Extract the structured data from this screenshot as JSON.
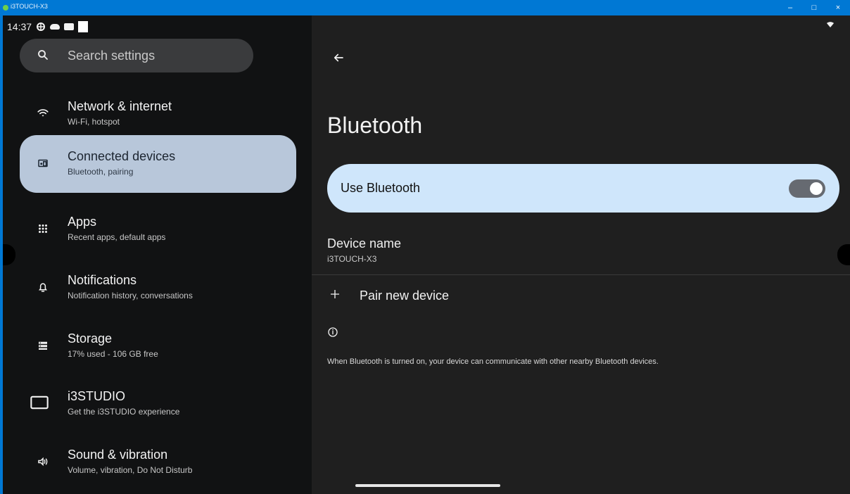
{
  "window": {
    "title": "i3TOUCH-X3",
    "controls": [
      "–",
      "□",
      "×"
    ]
  },
  "status_bar": {
    "time": "14:37",
    "icons": [
      "vpn-icon",
      "cloud-icon",
      "dvr-icon",
      "white-square-icon"
    ],
    "right_icons": [
      "wifi-icon"
    ]
  },
  "search": {
    "placeholder": "Search settings",
    "icon": "search-icon"
  },
  "sidebar": {
    "items": [
      {
        "label": "Network & internet",
        "sublabel": "Wi-Fi, hotspot",
        "icon": "wifi-icon",
        "active": false
      },
      {
        "label": "Connected devices",
        "sublabel": "Bluetooth, pairing",
        "icon": "connected-devices-icon",
        "active": true
      },
      {
        "label": "Apps",
        "sublabel": "Recent apps, default apps",
        "icon": "apps-grid-icon",
        "active": false
      },
      {
        "label": "Notifications",
        "sublabel": "Notification history, conversations",
        "icon": "bell-icon",
        "active": false
      },
      {
        "label": "Storage",
        "sublabel": "17% used - 106 GB free",
        "icon": "storage-icon",
        "active": false
      },
      {
        "label": "i3STUDIO",
        "sublabel": "Get the i3STUDIO experience",
        "icon": "display-icon",
        "active": false
      },
      {
        "label": "Sound & vibration",
        "sublabel": "Volume, vibration, Do Not Disturb",
        "icon": "speaker-icon",
        "active": false
      }
    ]
  },
  "main": {
    "back_icon": "back-arrow-icon",
    "title": "Bluetooth",
    "use_bluetooth": {
      "label": "Use Bluetooth",
      "enabled": true
    },
    "device_name": {
      "title": "Device name",
      "value": "i3TOUCH-X3"
    },
    "pair_new_device": "Pair new device",
    "info_icon": "info-icon",
    "info_text": "When Bluetooth is turned on, your device can communicate with other nearby Bluetooth devices."
  },
  "colors": {
    "window_titlebar": "#0078d4",
    "left_pane": "#111213",
    "right_pane": "#1f1f1f",
    "active_nav": "#b8c7da",
    "bluetooth_card": "#cfe6fb",
    "toggle_track": "#666a71"
  }
}
